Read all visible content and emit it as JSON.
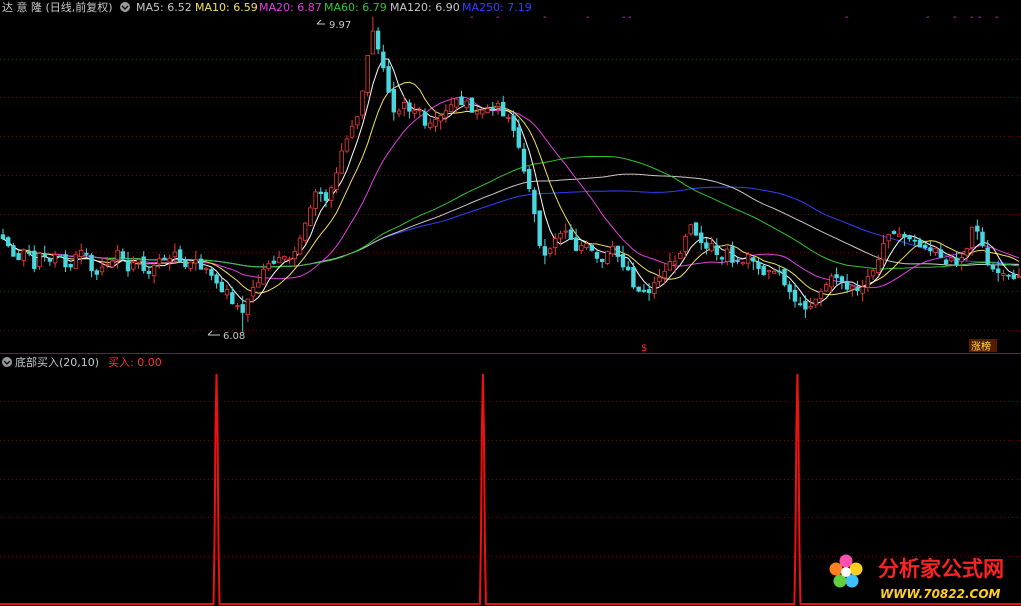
{
  "colors": {
    "background": "#000000",
    "grid": "#7a0000",
    "divider": "#c80000",
    "up_candle": "#e83a3a",
    "down_candle": "#48d7df",
    "ma5": "#ffffff",
    "ma10": "#f2e060",
    "ma20": "#e040e0",
    "ma60": "#2fc52f",
    "ma120": "#c8c8c8",
    "ma250": "#3040ff",
    "signal": "#ee1111",
    "marker": "#d040d0",
    "header_text": "#c8c8c8",
    "buy_text": "#ff3030"
  },
  "main_panel": {
    "title": "达 意 隆 (日线,前复权)",
    "icon": "circle-dot-icon",
    "legend": [
      {
        "key": "ma5",
        "text": "MA5: 6.52"
      },
      {
        "key": "ma10",
        "text": "MA10: 6.59"
      },
      {
        "key": "ma20",
        "text": "MA20: 6.87"
      },
      {
        "key": "ma60",
        "text": "MA60: 6.79"
      },
      {
        "key": "ma120",
        "text": "MA120: 6.90"
      },
      {
        "key": "ma250",
        "text": "MA250: 7.19"
      }
    ],
    "high_label": "9.97",
    "low_label": "6.08",
    "bottom_marker": "$",
    "tag_label": "涨榜"
  },
  "sub_panel": {
    "title": "底部买入(20,10)",
    "value_label": "买入: 0.00",
    "icon": "circle-dot-icon"
  },
  "watermark": {
    "text": "分析家公式网",
    "url": "WWW.70822.COM",
    "icon": "flower-logo-icon"
  },
  "chart_data": [
    {
      "type": "candlestick",
      "title": "达 意 隆 (日线,前复权)",
      "ylim": [
        5.8,
        10.1
      ],
      "highest": 9.97,
      "lowest": 6.08,
      "series": [
        {
          "name": "MA5",
          "last": 6.52
        },
        {
          "name": "MA10",
          "last": 6.59
        },
        {
          "name": "MA20",
          "last": 6.87
        },
        {
          "name": "MA60",
          "last": 6.79
        },
        {
          "name": "MA120",
          "last": 6.9
        },
        {
          "name": "MA250",
          "last": 7.19
        }
      ],
      "close_path": [
        7.2,
        7.05,
        6.95,
        7.1,
        6.85,
        7.0,
        6.9,
        7.05,
        6.8,
        6.9,
        7.1,
        6.95,
        6.7,
        6.85,
        6.95,
        7.0,
        6.8,
        6.9,
        6.85,
        6.75,
        6.9,
        6.95,
        7.0,
        6.9,
        6.85,
        6.95,
        6.8,
        6.75,
        6.6,
        6.5,
        6.35,
        6.2,
        6.5,
        6.6,
        6.8,
        6.9,
        7.0,
        6.95,
        7.1,
        7.3,
        7.6,
        7.85,
        7.7,
        7.95,
        8.3,
        8.6,
        8.8,
        9.3,
        9.97,
        9.6,
        9.1,
        8.7,
        8.95,
        8.8,
        8.9,
        8.7,
        8.75,
        8.85,
        8.9,
        9.0,
        8.95,
        8.9,
        8.85,
        8.9,
        8.95,
        8.8,
        8.7,
        8.4,
        8.0,
        7.5,
        7.0,
        7.1,
        7.2,
        7.3,
        7.1,
        7.05,
        7.2,
        7.0,
        6.95,
        7.1,
        6.9,
        6.85,
        6.6,
        6.5,
        6.55,
        6.7,
        6.8,
        6.9,
        7.05,
        7.4,
        7.3,
        7.1,
        7.15,
        6.95,
        7.05,
        6.85,
        6.9,
        6.95,
        6.8,
        6.75,
        6.85,
        6.7,
        6.6,
        6.4,
        6.35,
        6.3,
        6.5,
        6.6,
        6.7,
        6.65,
        6.55,
        6.5,
        6.6,
        6.75,
        7.0,
        7.2,
        7.3,
        7.2,
        7.15,
        7.1,
        7.0,
        7.05,
        6.95,
        6.9,
        6.85,
        7.0,
        7.35,
        7.2,
        6.85,
        6.7,
        6.8,
        6.7,
        6.65
      ]
    },
    {
      "type": "line",
      "title": "底部买入(20,10)",
      "ylim": [
        0,
        1
      ],
      "signal_positions": [
        0.212,
        0.473,
        0.781
      ],
      "current": 0.0
    }
  ]
}
